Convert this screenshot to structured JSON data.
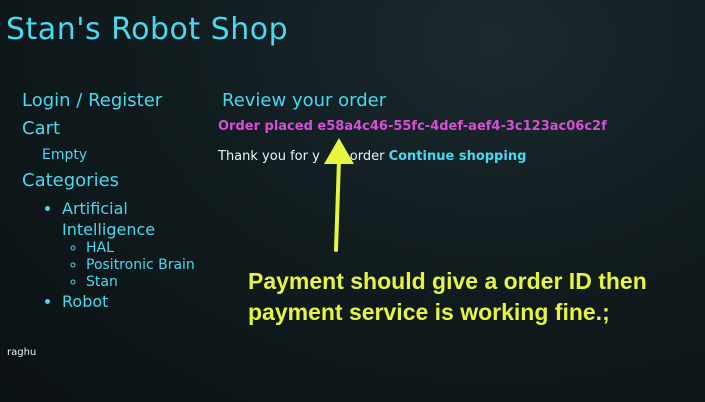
{
  "header": {
    "site_title": "Stan's Robot Shop"
  },
  "sidebar": {
    "login_register": "Login / Register",
    "cart_label": "Cart",
    "cart_status": "Empty",
    "categories_label": "Categories",
    "categories": [
      {
        "label": "Artificial Intelligence",
        "items": [
          "HAL",
          "Positronic Brain",
          "Stan"
        ]
      },
      {
        "label": "Robot",
        "items": []
      }
    ],
    "user": "raghu"
  },
  "main": {
    "heading": "Review your order",
    "order_prefix": "Order placed",
    "order_id": "e58a4c46-55fc-4def-aef4-3c123ac06c2f",
    "thanks_text": "Thank you for y",
    "thanks_text_tail": "order",
    "continue_label": "Continue shopping"
  },
  "annotation": {
    "text": "Payment should give a order ID then payment service is working fine.;",
    "color": "#e6f53d"
  },
  "colors": {
    "accent": "#47d9ef",
    "order": "#d84ed8",
    "background": "#111c1f"
  }
}
